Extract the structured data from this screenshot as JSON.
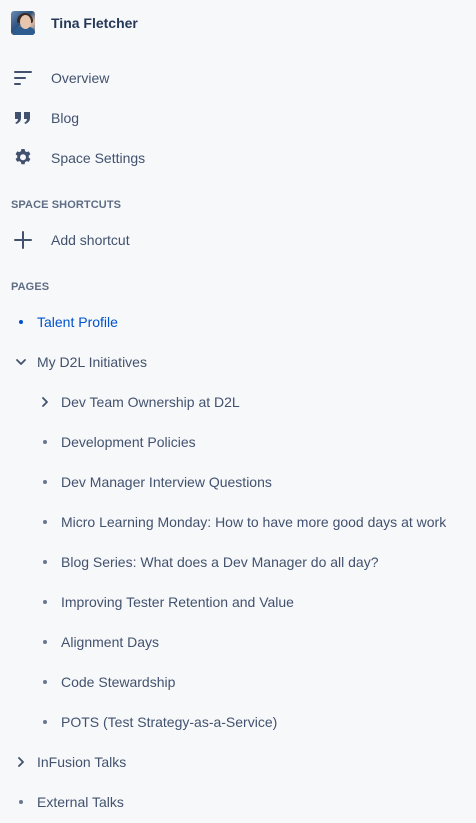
{
  "space": {
    "name": "Tina Fletcher"
  },
  "nav": {
    "overview": {
      "label": "Overview",
      "icon": "overview-lines-icon"
    },
    "blog": {
      "label": "Blog",
      "icon": "quote-icon"
    },
    "settings": {
      "label": "Space Settings",
      "icon": "gear-icon"
    }
  },
  "shortcuts": {
    "heading": "SPACE SHORTCUTS",
    "add_label": "Add shortcut",
    "add_icon": "plus-icon"
  },
  "pages": {
    "heading": "PAGES",
    "items": [
      {
        "label": "Talent Profile",
        "marker": "bullet",
        "active": true
      },
      {
        "label": "My D2L Initiatives",
        "marker": "chevron-down",
        "active": false
      },
      {
        "label": "Dev Team Ownership at D2L",
        "marker": "chevron-right",
        "active": false
      },
      {
        "label": "Development Policies",
        "marker": "bullet",
        "active": false
      },
      {
        "label": "Dev Manager Interview Questions",
        "marker": "bullet",
        "active": false
      },
      {
        "label": "Micro Learning Monday: How to have more good days at work",
        "marker": "bullet",
        "active": false
      },
      {
        "label": "Blog Series: What does a Dev Manager do all day?",
        "marker": "bullet",
        "active": false
      },
      {
        "label": "Improving Tester Retention and Value",
        "marker": "bullet",
        "active": false
      },
      {
        "label": "Alignment Days",
        "marker": "bullet",
        "active": false
      },
      {
        "label": "Code Stewardship",
        "marker": "bullet",
        "active": false
      },
      {
        "label": "POTS (Test Strategy-as-a-Service)",
        "marker": "bullet",
        "active": false
      },
      {
        "label": "InFusion Talks",
        "marker": "chevron-right",
        "active": false
      },
      {
        "label": "External Talks",
        "marker": "bullet",
        "active": false
      }
    ]
  },
  "colors": {
    "sidebar_bg": "#F7F8FA",
    "text": "#42526E",
    "active": "#0052CC",
    "heading": "#5E6C84"
  }
}
